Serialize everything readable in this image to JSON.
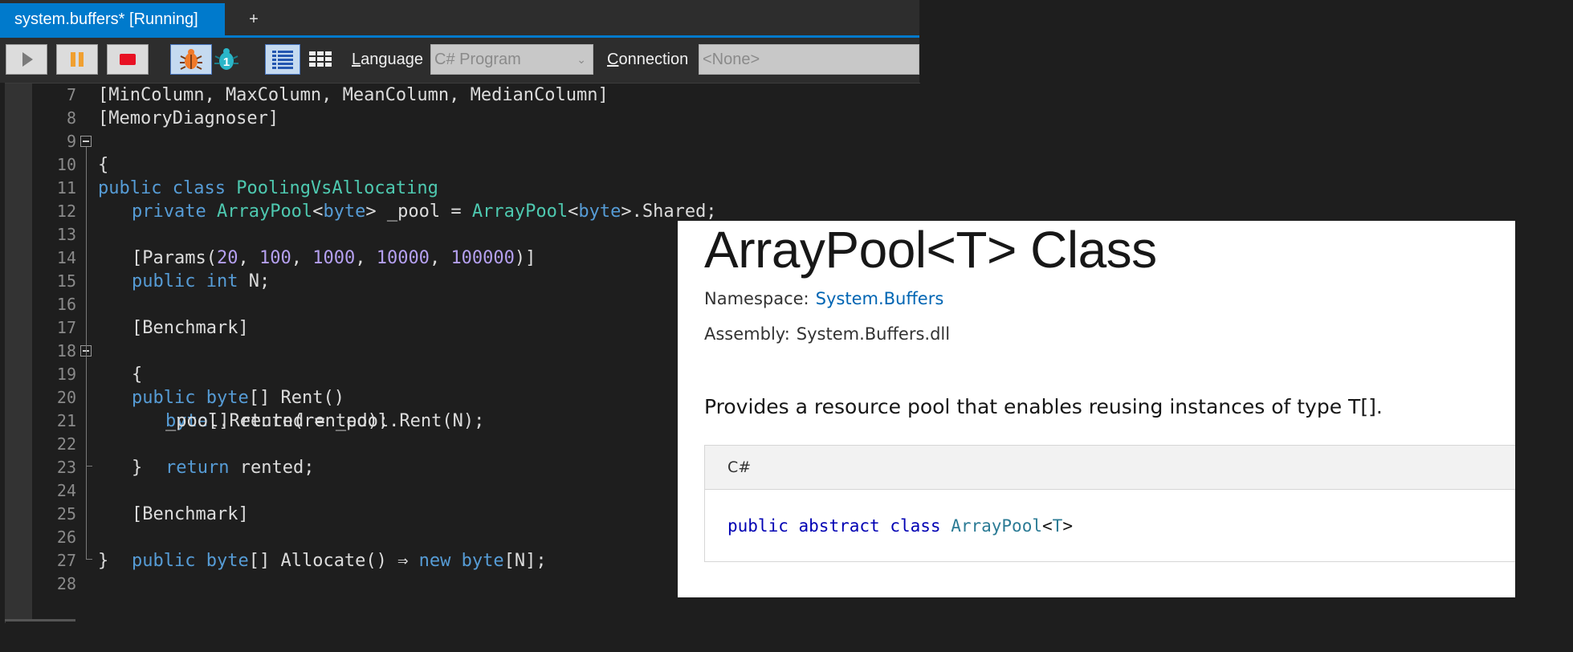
{
  "tabbar": {
    "tab_title": "system.buffers* [Running]",
    "new_tab": "+"
  },
  "toolbar": {
    "language_label_accel": "L",
    "language_label_rest": "anguage",
    "language_value": "C# Program",
    "connection_label_accel": "C",
    "connection_label_rest": "onnection",
    "connection_value": "<None>",
    "debug_badge": "1"
  },
  "editor": {
    "lines": [
      {
        "n": "7"
      },
      {
        "n": "8"
      },
      {
        "n": "9"
      },
      {
        "n": "10"
      },
      {
        "n": "11"
      },
      {
        "n": "12"
      },
      {
        "n": "13"
      },
      {
        "n": "14"
      },
      {
        "n": "15"
      },
      {
        "n": "16"
      },
      {
        "n": "17"
      },
      {
        "n": "18"
      },
      {
        "n": "19"
      },
      {
        "n": "20"
      },
      {
        "n": "21"
      },
      {
        "n": "22"
      },
      {
        "n": "23"
      },
      {
        "n": "24"
      },
      {
        "n": "25"
      },
      {
        "n": "26"
      },
      {
        "n": "27"
      },
      {
        "n": "28"
      }
    ],
    "tok": {
      "l7": "[MinColumn, MaxColumn, MeanColumn, MedianColumn]",
      "l8": "[MemoryDiagnoser]",
      "public": "public",
      "class": "class",
      "PoolingVsAllocating": "PoolingVsAllocating",
      "open_brace": "{",
      "close_brace": "}",
      "private": "private",
      "ArrayPool": "ArrayPool",
      "lt": "<",
      "gt": ">",
      "byte": "byte",
      "l11_mid": " _pool = ",
      "l11_end": ".Shared;",
      "params_open": "[Params(",
      "comma": ", ",
      "n20": "20",
      "n100": "100",
      "n1000": "1000",
      "n10000": "10000",
      "n100000": "100000",
      "params_close": ")]",
      "int": "int",
      "n_decl": " N;",
      "benchmark": "[Benchmark]",
      "arr_brackets": "[]",
      "rent_sig": " Rent()",
      "l20_rest": " rented = _pool.Rent(N);",
      "l21": "_pool.Return(rented);",
      "return": "return",
      "l22_rest": " rented;",
      "alloc_sig": " Allocate() ⇒ ",
      "new": "new",
      "n_index": "[N];"
    }
  },
  "doc": {
    "title": "ArrayPool<T> Class",
    "namespace_label": "Namespace:",
    "namespace_value": "System.Buffers",
    "assembly_label": "Assembly:",
    "assembly_value": "System.Buffers.dll",
    "description": "Provides a resource pool that enables reusing instances of type T[].",
    "code_lang": "C#",
    "code": {
      "public": "public",
      "abstract": "abstract",
      "class": "class",
      "type": "ArrayPool",
      "lt": "<",
      "param": "T",
      "gt": ">"
    }
  },
  "colors": {
    "accent": "#007acc",
    "keyword": "#569cd6",
    "type": "#4ec9b0",
    "number": "#b5a0f0",
    "doc_link": "#0065b3"
  }
}
